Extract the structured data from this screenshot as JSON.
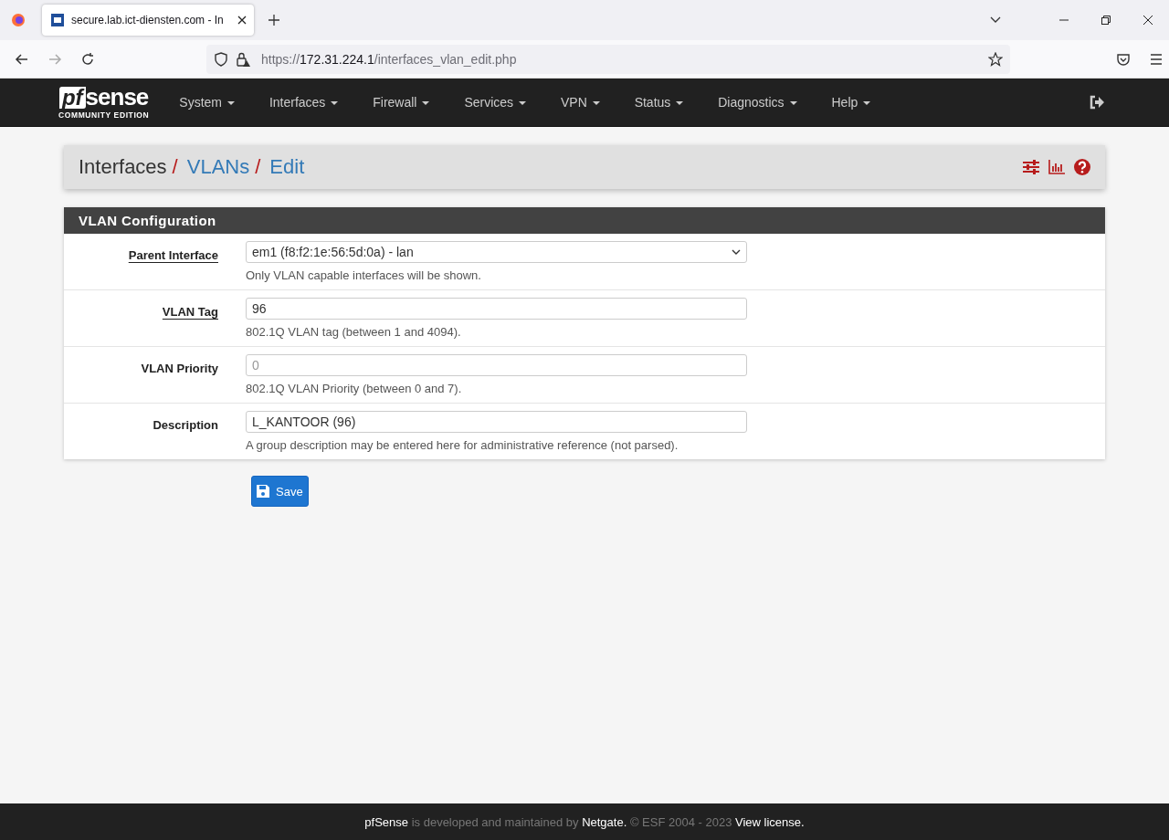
{
  "browser": {
    "tab_title": "secure.lab.ict-diensten.com - In",
    "url": {
      "scheme": "https://",
      "host": "172.31.224.1",
      "path": "/interfaces_vlan_edit.php"
    }
  },
  "brand": {
    "pf": "pf",
    "sense": "sense",
    "edition": "COMMUNITY EDITION"
  },
  "nav": [
    "System",
    "Interfaces",
    "Firewall",
    "Services",
    "VPN",
    "Status",
    "Diagnostics",
    "Help"
  ],
  "breadcrumb_separator": "/",
  "breadcrumb": [
    {
      "label": "Interfaces",
      "link": false
    },
    {
      "label": "VLANs",
      "link": true
    },
    {
      "label": "Edit",
      "link": true
    }
  ],
  "panel": {
    "title": "VLAN Configuration",
    "fields": [
      {
        "label": "Parent Interface",
        "required": true,
        "kind": "select",
        "value": "em1 (f8:f2:1e:56:5d:0a) - lan",
        "help": "Only VLAN capable interfaces will be shown."
      },
      {
        "label": "VLAN Tag",
        "required": true,
        "kind": "text",
        "value": "96",
        "help": "802.1Q VLAN tag (between 1 and 4094)."
      },
      {
        "label": "VLAN Priority",
        "required": false,
        "kind": "text",
        "placeholder": "0",
        "help": "802.1Q VLAN Priority (between 0 and 7)."
      },
      {
        "label": "Description",
        "required": false,
        "kind": "text",
        "value": "L_KANTOOR (96)",
        "help": "A group description may be entered here for administrative reference (not parsed)."
      }
    ]
  },
  "save_button": "Save",
  "footer": [
    {
      "kind": "link",
      "text": "pfSense"
    },
    {
      "kind": "text",
      "text": " is developed and maintained by "
    },
    {
      "kind": "link",
      "text": "Netgate."
    },
    {
      "kind": "text",
      "text": " © ESF 2004 - 2023 "
    },
    {
      "kind": "link",
      "text": "View license."
    }
  ]
}
